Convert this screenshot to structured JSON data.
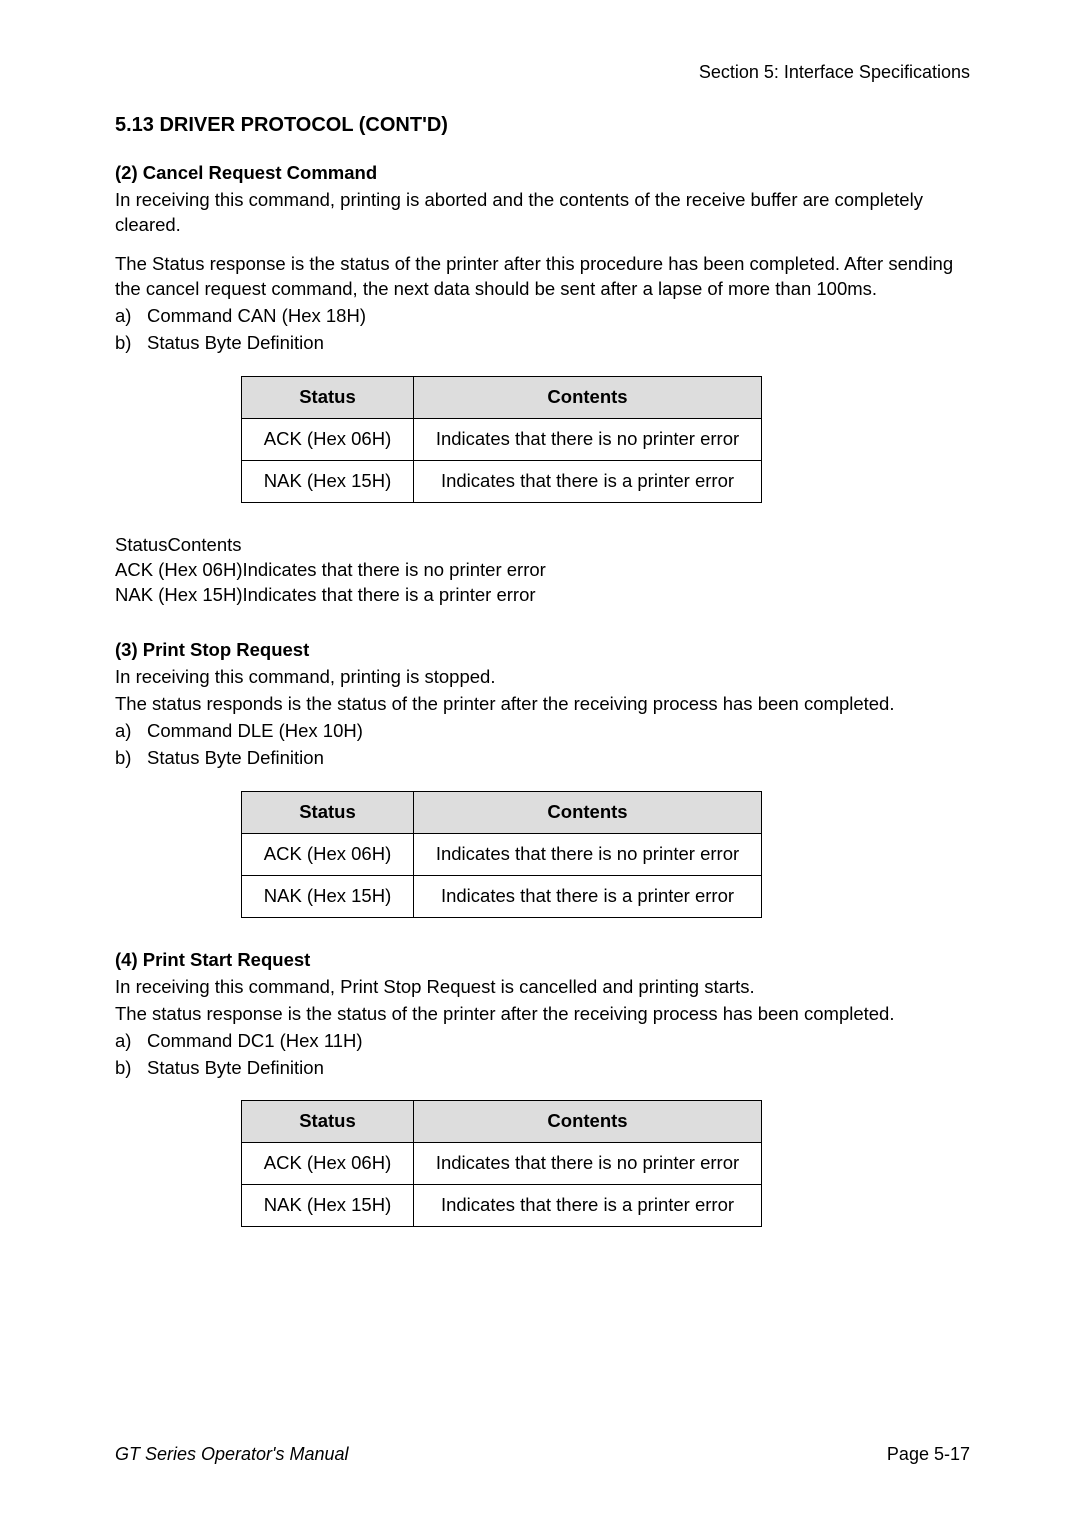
{
  "header": {
    "right_text": "Section 5: Interface Specifications"
  },
  "section_title": "5.13 DRIVER PROTOCOL (CONT'D)",
  "sub2": {
    "heading": "(2) Cancel Request Command",
    "p1": "In receiving this command, printing is aborted and the contents of the receive buffer are completely cleared.",
    "p2": "The Status response is the status of the printer after this procedure has been completed. After sending the cancel request command, the next data should be sent after a lapse of more than 100ms.",
    "li_a_marker": "a)",
    "li_a_text": "Command CAN (Hex 18H)",
    "li_b_marker": "b)",
    "li_b_text": "Status Byte Definition"
  },
  "table1": {
    "h1": "Status",
    "h2": "Contents",
    "r1c1": "ACK (Hex 06H)",
    "r1c2": "Indicates that there is no printer error",
    "r2c1": "NAK (Hex 15H)",
    "r2c2": "Indicates that there is a printer error"
  },
  "status_contents": {
    "line1": "StatusContents",
    "line2": "ACK (Hex 06H)Indicates that there is no printer error",
    "line3": "NAK (Hex 15H)Indicates that there is a printer error"
  },
  "sub3": {
    "heading": "(3) Print Stop Request",
    "p1": "In receiving this command, printing is stopped.",
    "p2": "The status responds is the status of the printer after the receiving process has been completed.",
    "li_a_marker": "a)",
    "li_a_text": "Command DLE (Hex 10H)",
    "li_b_marker": "b)",
    "li_b_text": "Status Byte Definition"
  },
  "table2": {
    "h1": "Status",
    "h2": "Contents",
    "r1c1": "ACK (Hex 06H)",
    "r1c2": "Indicates that there is no printer error",
    "r2c1": "NAK (Hex 15H)",
    "r2c2": "Indicates that there is a printer error"
  },
  "sub4": {
    "heading": "(4) Print Start Request",
    "p1": "In receiving this command, Print Stop Request is cancelled and printing starts.",
    "p2": "The status response is the status of the printer after the receiving process has been completed.",
    "li_a_marker": "a)",
    "li_a_text": "Command DC1 (Hex 11H)",
    "li_b_marker": "b)",
    "li_b_text": "Status Byte Definition"
  },
  "table3": {
    "h1": "Status",
    "h2": "Contents",
    "r1c1": "ACK (Hex 06H)",
    "r1c2": "Indicates that there is no printer error",
    "r2c1": "NAK (Hex 15H)",
    "r2c2": "Indicates that there is a printer error"
  },
  "footer": {
    "left": "GT Series Operator's Manual",
    "right": "Page 5-17"
  }
}
